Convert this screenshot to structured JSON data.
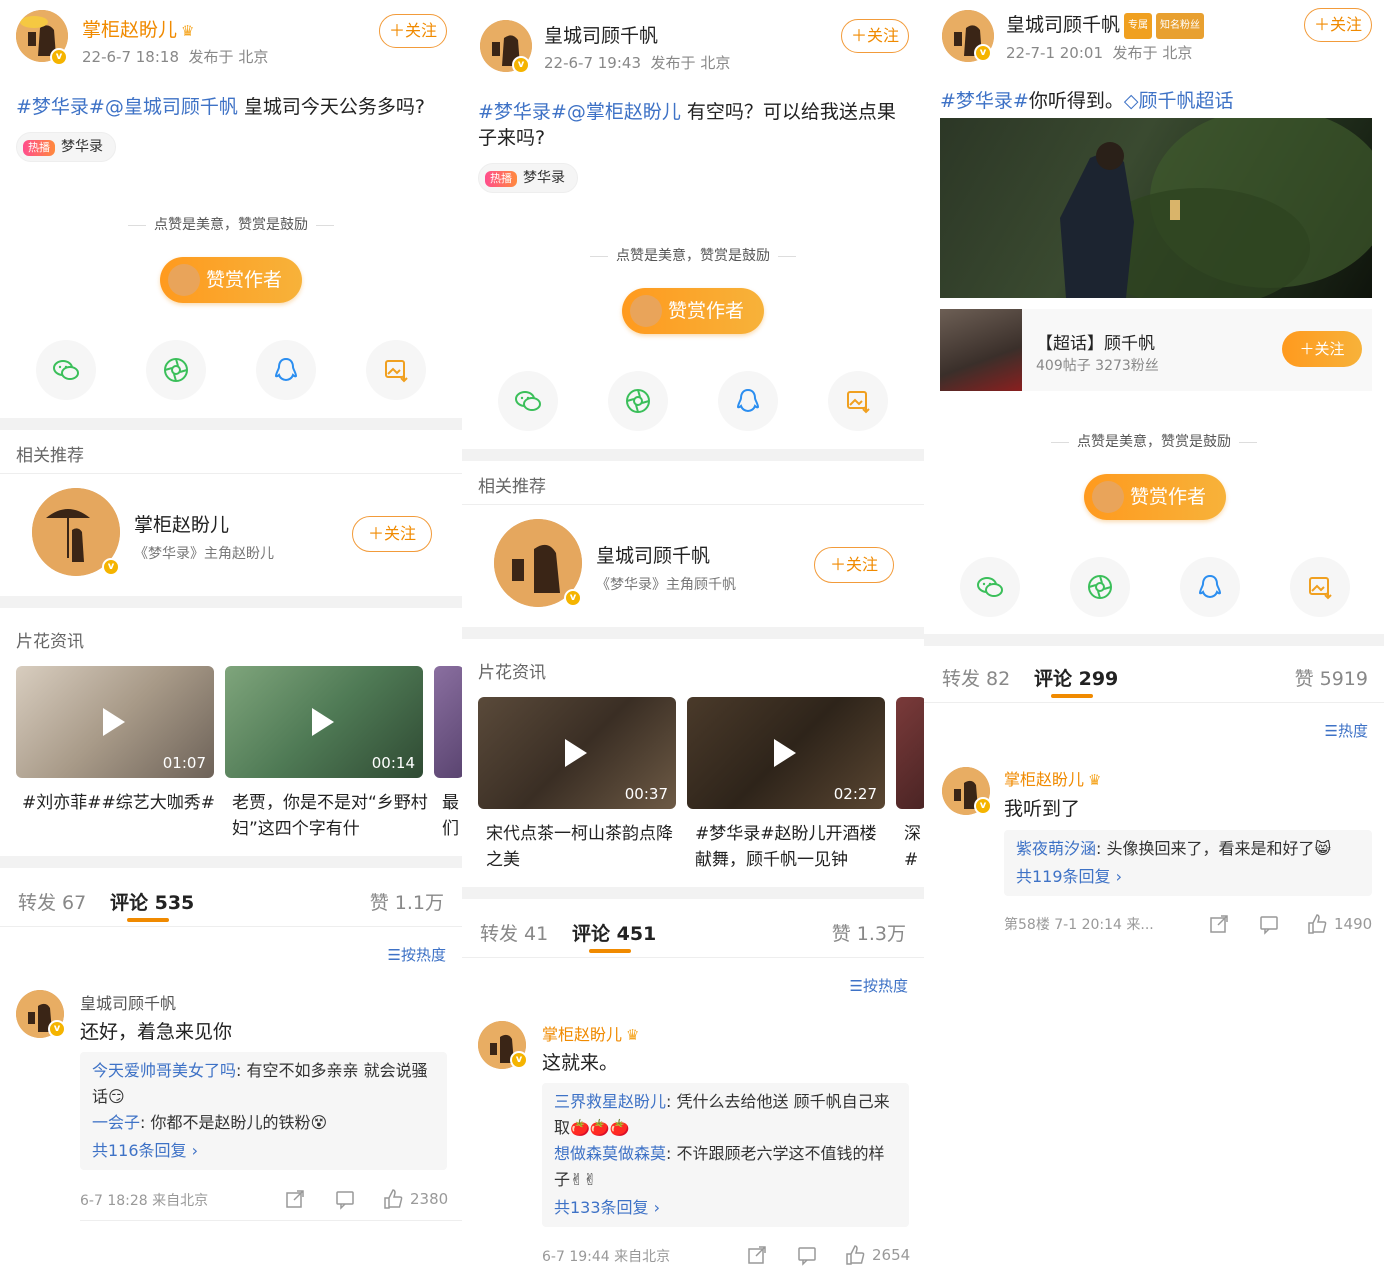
{
  "columns": [
    {
      "author": "掌柜赵盼儿",
      "author_orange": true,
      "crown": true,
      "meta_time": "22-6-7 18:18",
      "meta_loc": "发布于 北京",
      "follow_label": "＋关注",
      "topic_text": "#梦华录#@皇城司顾千帆",
      "body_text": " 皇城司今天公务多吗?",
      "hot_badge": "热播",
      "hot_chip_text": "梦华录",
      "reward_line": "点赞是美意，赞赏是鼓励",
      "reward_btn": "赞赏作者",
      "related_title": "相关推荐",
      "rec_name": "掌柜赵盼儿",
      "rec_desc": "《梦华录》主角赵盼儿",
      "rec_follow": "＋关注",
      "clips_title": "片花资讯",
      "videos": [
        {
          "duration": "01:07",
          "caption": "#刘亦菲##综艺大咖秀#"
        },
        {
          "duration": "00:14",
          "caption": "老贾，你是不是对“乡野村妇”这四个字有什"
        },
        {
          "duration": "",
          "caption": "最们"
        }
      ],
      "stats": {
        "repost": "转发 67",
        "comment": "评论 535",
        "like": "赞 1.1万"
      },
      "sort_label": "☰按热度",
      "comment": {
        "name": "皇城司顾千帆",
        "text": "还好，着急来见你",
        "replies": [
          {
            "name": "今天爱帅哥美女了吗",
            "text": ": 有空不如多亲亲  就会说骚话😏"
          },
          {
            "name": "一会子",
            "text": ": 你都不是赵盼儿的铁粉😵"
          }
        ],
        "more": "共116条回复 ›",
        "footer": "6-7 18:28  来自北京",
        "likes": "2380"
      }
    },
    {
      "author": "皇城司顾千帆",
      "author_orange": false,
      "crown": false,
      "meta_time": "22-6-7 19:43",
      "meta_loc": "发布于 北京",
      "follow_label": "＋关注",
      "topic_text": "#梦华录#@掌柜赵盼儿",
      "body_text": " 有空吗？可以给我送点果子来吗?",
      "hot_badge": "热播",
      "hot_chip_text": "梦华录",
      "reward_line": "点赞是美意，赞赏是鼓励",
      "reward_btn": "赞赏作者",
      "related_title": "相关推荐",
      "rec_name": "皇城司顾千帆",
      "rec_desc": "《梦华录》主角顾千帆",
      "rec_follow": "＋关注",
      "clips_title": "片花资讯",
      "videos": [
        {
          "duration": "00:37",
          "caption": "宋代点茶一柯山茶韵点降之美"
        },
        {
          "duration": "02:27",
          "caption": "#梦华录#赵盼儿开酒楼献舞，顾千帆一见钟"
        },
        {
          "duration": "",
          "caption": "深#梦"
        }
      ],
      "stats": {
        "repost": "转发 41",
        "comment": "评论 451",
        "like": "赞 1.3万"
      },
      "sort_label": "☰按热度",
      "comment": {
        "name": "掌柜赵盼儿",
        "text": "这就来。",
        "replies": [
          {
            "name": "三界救星赵盼儿",
            "text": ": 凭什么去给他送 顾千帆自己来取🍅🍅🍅"
          },
          {
            "name": "想做森莫做森莫",
            "text": ": 不许跟顾老六学这不值钱的样子✌✌"
          }
        ],
        "more": "共133条回复 ›",
        "footer": "6-7 19:44  来自北京",
        "likes": "2654"
      }
    },
    {
      "author": "皇城司顾千帆",
      "tag1": "专属",
      "tag2": "知名粉丝",
      "meta_time": "22-7-1 20:01",
      "meta_loc": "发布于 北京",
      "follow_label": "＋关注",
      "topic_text": "#梦华录#",
      "body_text": "你听得到。",
      "link_text": "◇顾千帆超话",
      "supertopic": {
        "title": "【超话】顾千帆",
        "sub": "409帖子 3273粉丝",
        "follow": "＋关注"
      },
      "reward_line": "点赞是美意，赞赏是鼓励",
      "reward_btn": "赞赏作者",
      "stats": {
        "repost": "转发 82",
        "comment": "评论 299",
        "like": "赞 5919"
      },
      "sort_label": "☰热度",
      "comment": {
        "name": "掌柜赵盼儿",
        "text": "我听到了",
        "replies": [
          {
            "name": "紫夜萌汐涵",
            "text": ": 头像换回来了，看来是和好了😸"
          }
        ],
        "more": "共119条回复 ›",
        "footer": "第58楼  7-1 20:14  来...",
        "likes": "1490"
      }
    }
  ],
  "colors": {
    "accent": "#f08a00",
    "link": "#3e72c6",
    "gap": "#f2f2f2"
  },
  "icons": [
    "wechat-icon",
    "moments-icon",
    "qq-icon",
    "save-image-icon",
    "share-icon",
    "comment-icon",
    "like-icon",
    "play-icon",
    "vip-badge-icon",
    "crown-icon"
  ]
}
